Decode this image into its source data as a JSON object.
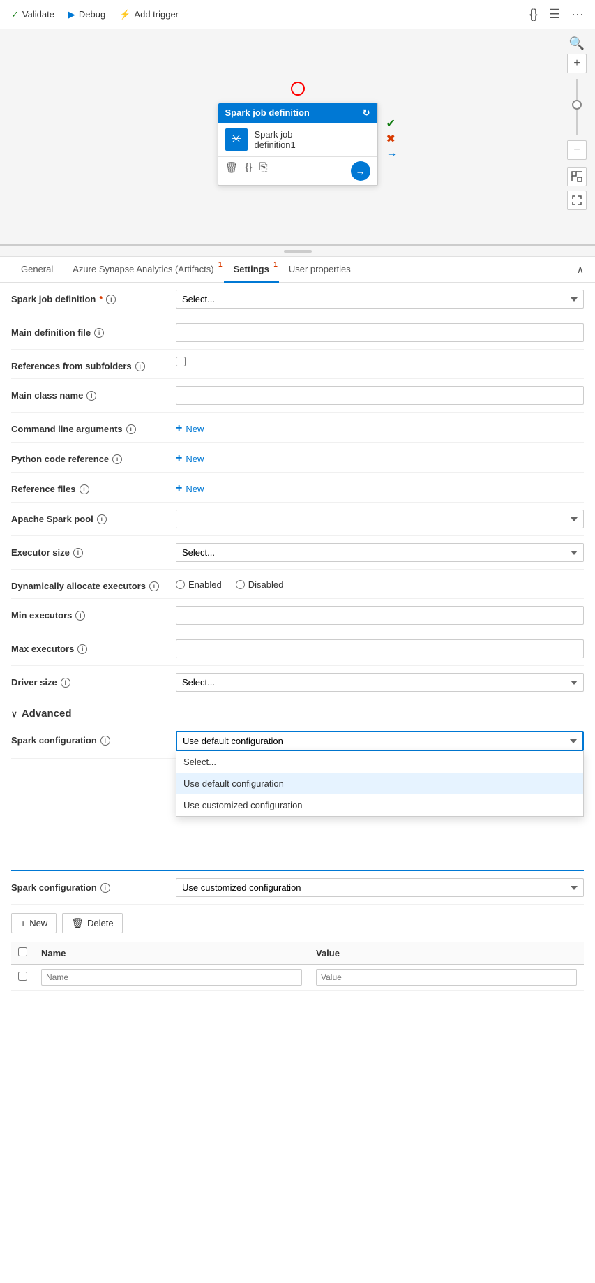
{
  "toolbar": {
    "validate_label": "Validate",
    "debug_label": "Debug",
    "add_trigger_label": "Add trigger"
  },
  "canvas": {
    "node": {
      "header": "Spark job definition",
      "title_line1": "Spark job",
      "title_line2": "definition1"
    },
    "zoom_plus": "+",
    "zoom_minus": "−"
  },
  "tabs": [
    {
      "id": "general",
      "label": "General",
      "badge": ""
    },
    {
      "id": "artifacts",
      "label": "Azure Synapse Analytics (Artifacts)",
      "badge": "1"
    },
    {
      "id": "settings",
      "label": "Settings",
      "badge": "1",
      "active": true
    },
    {
      "id": "user-props",
      "label": "User properties",
      "badge": ""
    }
  ],
  "settings": {
    "spark_job_def_label": "Spark job definition",
    "spark_job_def_placeholder": "Select...",
    "main_def_file_label": "Main definition file",
    "main_def_file_value": "",
    "refs_from_subfolders_label": "References from subfolders",
    "main_class_name_label": "Main class name",
    "main_class_name_value": "",
    "cmd_args_label": "Command line arguments",
    "cmd_args_new": "New",
    "python_ref_label": "Python code reference",
    "python_ref_new": "New",
    "ref_files_label": "Reference files",
    "ref_files_new": "New",
    "apache_spark_pool_label": "Apache Spark pool",
    "apache_spark_pool_value": "",
    "executor_size_label": "Executor size",
    "executor_size_placeholder": "Select...",
    "dyn_alloc_label": "Dynamically allocate executors",
    "dyn_alloc_enabled": "Enabled",
    "dyn_alloc_disabled": "Disabled",
    "min_executors_label": "Min executors",
    "min_executors_value": "",
    "max_executors_label": "Max executors",
    "max_executors_value": "",
    "driver_size_label": "Driver size",
    "driver_size_placeholder": "Select...",
    "advanced_label": "Advanced",
    "spark_config_label": "Spark configuration",
    "spark_config_selected": "Use default configuration",
    "spark_config_options": [
      {
        "id": "select",
        "label": "Select..."
      },
      {
        "id": "default",
        "label": "Use default configuration"
      },
      {
        "id": "custom",
        "label": "Use customized configuration"
      }
    ],
    "spark_config2_label": "Spark configuration",
    "spark_config2_selected": "Use customized configuration",
    "new_btn": "New",
    "delete_btn": "Delete",
    "table_col_name": "Name",
    "table_col_value": "Value",
    "table_name_placeholder": "Name",
    "table_value_placeholder": "Value"
  }
}
